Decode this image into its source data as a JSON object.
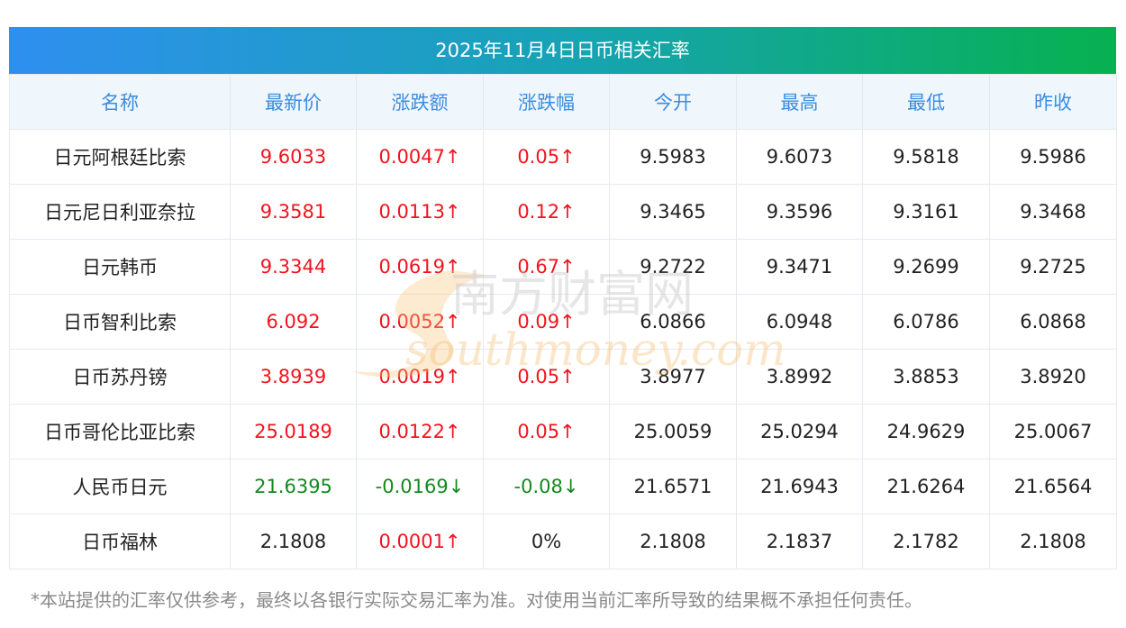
{
  "title": "2025年11月4日日币相关汇率",
  "columns": [
    "名称",
    "最新价",
    "涨跌额",
    "涨跌幅",
    "今开",
    "最高",
    "最低",
    "昨收"
  ],
  "rows": [
    {
      "name": "日元阿根廷比索",
      "latest": "9.6033",
      "change": "0.0047↑",
      "change_pct": "0.05↑",
      "open": "9.5983",
      "high": "9.6073",
      "low": "9.5818",
      "prev_close": "9.5986",
      "trend": "up"
    },
    {
      "name": "日元尼日利亚奈拉",
      "latest": "9.3581",
      "change": "0.0113↑",
      "change_pct": "0.12↑",
      "open": "9.3465",
      "high": "9.3596",
      "low": "9.3161",
      "prev_close": "9.3468",
      "trend": "up"
    },
    {
      "name": "日元韩币",
      "latest": "9.3344",
      "change": "0.0619↑",
      "change_pct": "0.67↑",
      "open": "9.2722",
      "high": "9.3471",
      "low": "9.2699",
      "prev_close": "9.2725",
      "trend": "up"
    },
    {
      "name": "日币智利比索",
      "latest": "6.092",
      "change": "0.0052↑",
      "change_pct": "0.09↑",
      "open": "6.0866",
      "high": "6.0948",
      "low": "6.0786",
      "prev_close": "6.0868",
      "trend": "up"
    },
    {
      "name": "日币苏丹镑",
      "latest": "3.8939",
      "change": "0.0019↑",
      "change_pct": "0.05↑",
      "open": "3.8977",
      "high": "3.8992",
      "low": "3.8853",
      "prev_close": "3.8920",
      "trend": "up"
    },
    {
      "name": "日币哥伦比亚比索",
      "latest": "25.0189",
      "change": "0.0122↑",
      "change_pct": "0.05↑",
      "open": "25.0059",
      "high": "25.0294",
      "low": "24.9629",
      "prev_close": "25.0067",
      "trend": "up"
    },
    {
      "name": "人民币日元",
      "latest": "21.6395",
      "change": "-0.0169↓",
      "change_pct": "-0.08↓",
      "open": "21.6571",
      "high": "21.6943",
      "low": "21.6264",
      "prev_close": "21.6564",
      "trend": "down"
    },
    {
      "name": "日币福林",
      "latest": "2.1808",
      "change": "0.0001↑",
      "change_pct": "0%",
      "open": "2.1808",
      "high": "2.1837",
      "low": "2.1782",
      "prev_close": "2.1808",
      "trend": "mixed"
    }
  ],
  "watermark": {
    "cn": "南方财富网",
    "en": "southmoney.com"
  },
  "footnote": "*本站提供的汇率仅供参考，最终以各银行实际交易汇率为准。对使用当前汇率所导致的结果概不承担任何责任。",
  "colors": {
    "up": "#f2141e",
    "down": "#14891e",
    "header_text": "#3a8de0",
    "header_bg": "#eff6fc",
    "title_gradient_start": "#2f8ff0",
    "title_gradient_end": "#07b150"
  }
}
